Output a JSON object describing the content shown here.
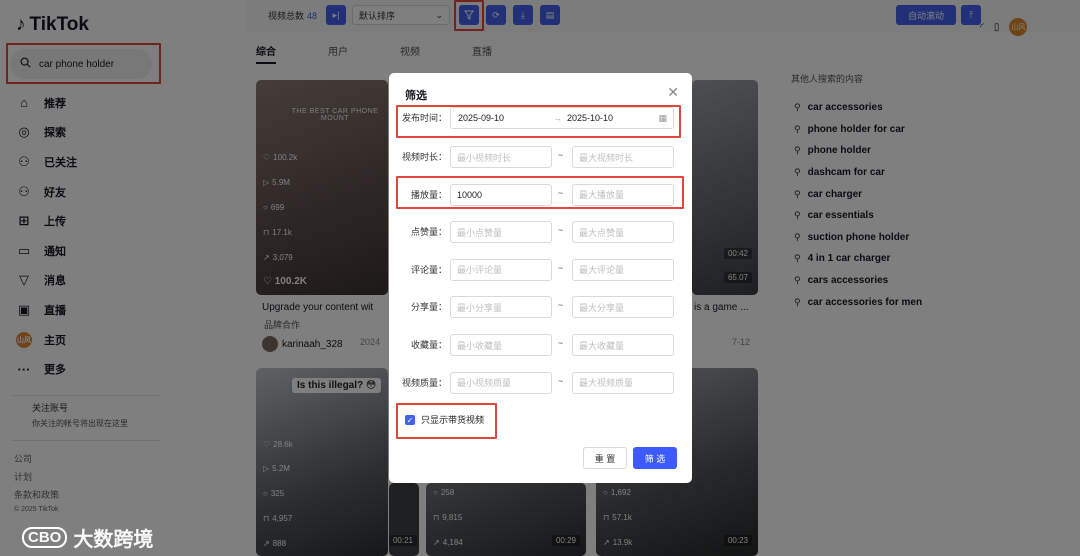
{
  "app": {
    "logo": "TikTok"
  },
  "search": {
    "value": "car phone holder"
  },
  "nav": [
    {
      "label": "推荐",
      "icon": "home-icon",
      "glyph": "⌂"
    },
    {
      "label": "探索",
      "icon": "compass-icon",
      "glyph": "◎"
    },
    {
      "label": "已关注",
      "icon": "person-plus-icon",
      "glyph": "⚇"
    },
    {
      "label": "好友",
      "icon": "friends-icon",
      "glyph": "⚇"
    },
    {
      "label": "上传",
      "icon": "upload-icon",
      "glyph": "⊞"
    },
    {
      "label": "通知",
      "icon": "message-icon",
      "glyph": "▭"
    },
    {
      "label": "消息",
      "icon": "send-icon",
      "glyph": "▽"
    },
    {
      "label": "直播",
      "icon": "live-icon",
      "glyph": "▣"
    },
    {
      "label": "主页",
      "icon": "profile-avatar",
      "glyph": "山风"
    },
    {
      "label": "更多",
      "icon": "more-icon",
      "glyph": "···"
    }
  ],
  "following": {
    "title": "关注账号",
    "note": "你关注的帐号将出现在这里"
  },
  "footer": {
    "links": [
      "公司",
      "计划",
      "条款和政策"
    ],
    "copyright": "© 2025 TikTok"
  },
  "toolbar": {
    "count_label": "视频总数",
    "count": "48",
    "sort": "默认排序",
    "auto_scroll": "自动滚动"
  },
  "tabs": [
    "综合",
    "用户",
    "视频",
    "直播"
  ],
  "videos": [
    {
      "title": "Upgrade your content wit",
      "sub": "品牌合作",
      "author": "karinaah_328",
      "date": "2024",
      "likes": "100.2k",
      "views": "5.9M",
      "comments": "699",
      "saves": "17.1k",
      "shares": "3,079",
      "big_views": "100.2K",
      "thumb_text": "THE BEST CAR PHONE MOUNT"
    },
    {
      "title": "is a game ...",
      "date": "7-12",
      "duration": "00:42",
      "views": "65.07"
    },
    {
      "caption": "Is this illegal? 😳",
      "likes": "28.6k",
      "views": "5.2M",
      "comments": "325",
      "saves": "4,957",
      "shares": "888"
    },
    {
      "comments": "258",
      "saves": "9,815",
      "shares": "4,184",
      "duration": "00:29"
    },
    {
      "comments": "1,692",
      "saves": "57.1k",
      "shares": "13.9k",
      "duration": "00:23"
    },
    {
      "duration": "00:21"
    }
  ],
  "related": {
    "title": "其他人搜索的内容",
    "items": [
      "car accessories",
      "phone holder for car",
      "phone holder",
      "dashcam for car",
      "car charger",
      "car essentials",
      "suction phone holder",
      "4 in 1 car charger",
      "cars accessories",
      "car accessories for men"
    ]
  },
  "modal": {
    "title": "筛选",
    "publish_time": {
      "label": "发布时间：",
      "start": "2025-09-10",
      "end": "2025-10-10"
    },
    "rows": [
      {
        "label": "视频时长：",
        "min": "",
        "max": "",
        "min_ph": "最小视频时长",
        "max_ph": "最大视频时长"
      },
      {
        "label": "播放量：",
        "min": "10000",
        "max": "",
        "min_ph": "",
        "max_ph": "最大播放量"
      },
      {
        "label": "点赞量：",
        "min": "",
        "max": "",
        "min_ph": "最小点赞量",
        "max_ph": "最大点赞量"
      },
      {
        "label": "评论量：",
        "min": "",
        "max": "",
        "min_ph": "最小评论量",
        "max_ph": "最大评论量"
      },
      {
        "label": "分享量：",
        "min": "",
        "max": "",
        "min_ph": "最小分享量",
        "max_ph": "最大分享量"
      },
      {
        "label": "收藏量：",
        "min": "",
        "max": "",
        "min_ph": "最小收藏量",
        "max_ph": "最大收藏量"
      },
      {
        "label": "视频质量：",
        "min": "",
        "max": "",
        "min_ph": "最小视频质量",
        "max_ph": "最大视频质量"
      }
    ],
    "tilde": "~",
    "checkbox_label": "只显示带货视频",
    "checked": true,
    "reset": "重 置",
    "submit": "筛 选"
  },
  "watermark": {
    "logo": "CBO",
    "text": "大数跨境"
  },
  "colors": {
    "accent": "#4361ee",
    "highlight": "#e0463e",
    "overlay": "rgba(0,0,0,0.5)"
  }
}
